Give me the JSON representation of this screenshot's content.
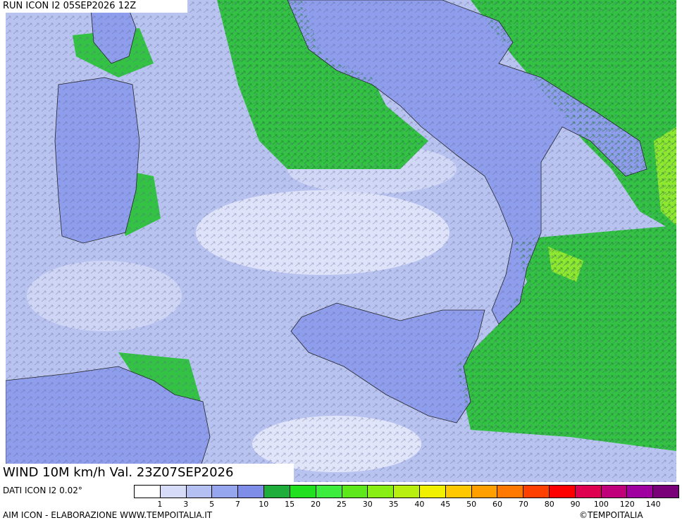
{
  "header": {
    "run_title": "RUN ICON I2 05SEP2026 12Z"
  },
  "footer": {
    "valid_title": "WIND 10M km/h Val. 23Z07SEP2026",
    "data_source": "DATI ICON I2 0.02°",
    "credit": "AIM ICON - ELABORAZIONE WWW.TEMPOITALIA.IT",
    "copyright": "©TEMPOITALIA"
  },
  "legend": {
    "colors": [
      "#ffffff",
      "#d6dcf7",
      "#b4c0f2",
      "#96a6ee",
      "#7d8de8",
      "#1fae3c",
      "#20e020",
      "#3ded3d",
      "#5ee81c",
      "#88ee14",
      "#b8ee10",
      "#f0f000",
      "#ffc800",
      "#ffa000",
      "#ff7800",
      "#ff4000",
      "#ff0000",
      "#e00050",
      "#c0007a",
      "#a000a0",
      "#7a007a"
    ],
    "ticks": [
      "1",
      "3",
      "5",
      "7",
      "10",
      "15",
      "20",
      "25",
      "30",
      "35",
      "40",
      "45",
      "50",
      "60",
      "70",
      "80",
      "90",
      "100",
      "120",
      "140"
    ]
  },
  "colors": {
    "sea_light": "#c9d0f2",
    "sea_mid": "#a7b2ee",
    "land": "#8f9ded",
    "wind_green": "#2fbf3f",
    "wind_strong": "#80e830"
  }
}
